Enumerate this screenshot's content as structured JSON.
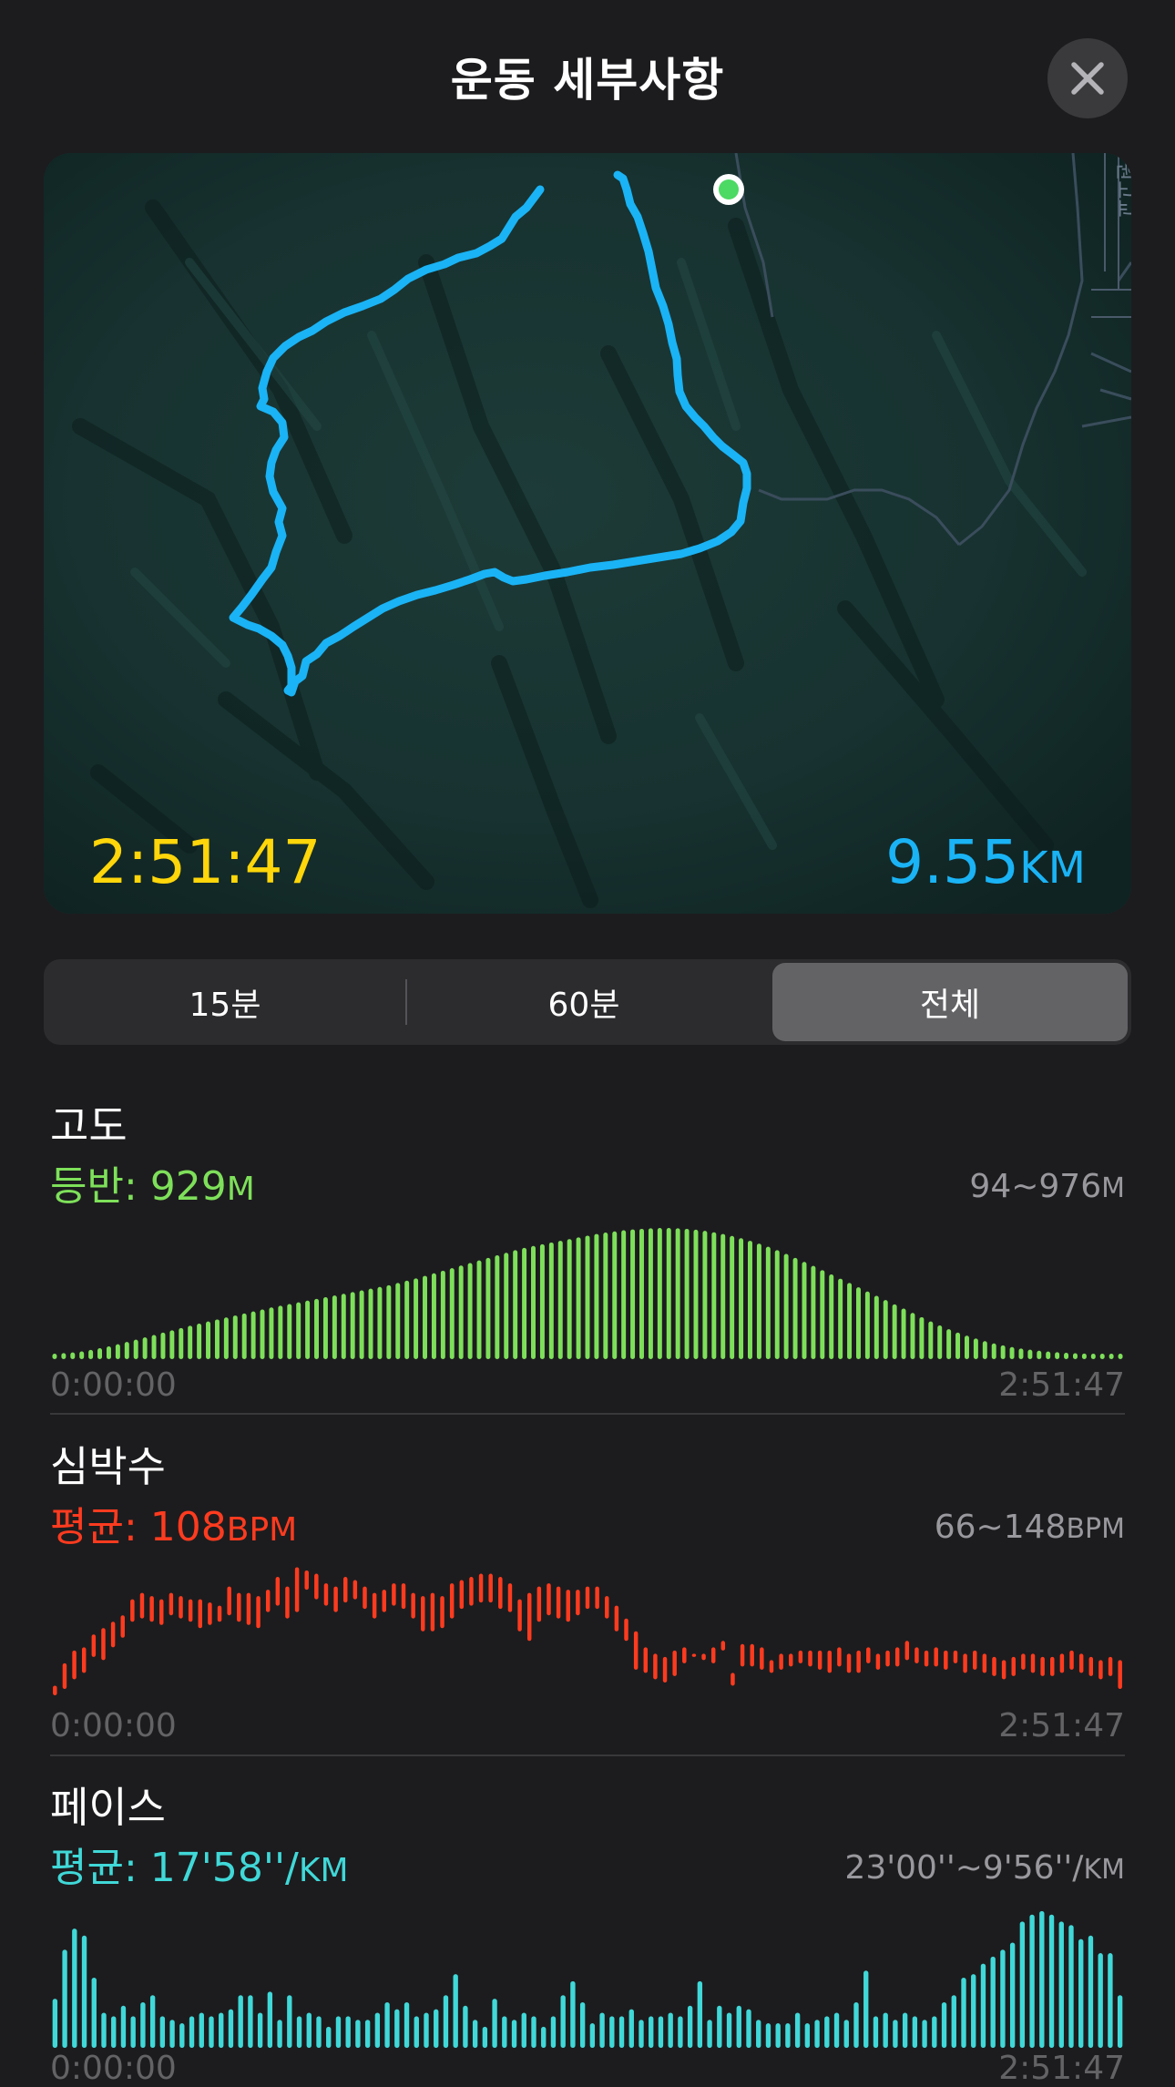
{
  "header": {
    "title": "운동 세부사항"
  },
  "map": {
    "duration": "2:51:47",
    "distance_value": "9.55",
    "distance_unit": "KM",
    "side_label": "원고교"
  },
  "range_tabs": [
    "15분",
    "60분",
    "전체"
  ],
  "selected_tab": "전체",
  "elevation": {
    "title": "고도",
    "stat_label": "등반: 929",
    "stat_unit": "M",
    "range_value": "94~976",
    "range_unit": "M",
    "start_time": "0:00:00",
    "end_time": "2:51:47",
    "color": "#7ee05a"
  },
  "heart_rate": {
    "title": "심박수",
    "stat_label": "평균: 108",
    "stat_unit": "BPM",
    "range_value": "66~148",
    "range_unit": "BPM",
    "start_time": "0:00:00",
    "end_time": "2:51:47",
    "color": "#ff3b1f"
  },
  "pace": {
    "title": "페이스",
    "stat_label": "평균: 17'58''/",
    "stat_unit": "KM",
    "range_value": "23'00''~9'56''/",
    "range_unit": "KM",
    "start_time": "0:00:00",
    "end_time": "2:51:47",
    "color": "#40d8d8"
  },
  "chart_data": [
    {
      "type": "bar",
      "name": "elevation",
      "ylim": [
        94,
        976
      ],
      "values": [
        94,
        98,
        103,
        110,
        120,
        132,
        145,
        160,
        176,
        192,
        208,
        225,
        242,
        258,
        274,
        290,
        305,
        320,
        334,
        348,
        362,
        376,
        390,
        404,
        418,
        430,
        442,
        454,
        466,
        478,
        490,
        502,
        514,
        526,
        538,
        550,
        562,
        574,
        590,
        606,
        622,
        640,
        658,
        676,
        694,
        712,
        730,
        748,
        766,
        784,
        802,
        820,
        836,
        850,
        862,
        874,
        886,
        898,
        910,
        922,
        934,
        944,
        952,
        960,
        966,
        970,
        974,
        976,
        976,
        974,
        970,
        964,
        956,
        946,
        934,
        920,
        904,
        886,
        866,
        844,
        820,
        794,
        766,
        738,
        710,
        680,
        650,
        620,
        590,
        560,
        530,
        500,
        470,
        440,
        410,
        380,
        350,
        320,
        292,
        266,
        242,
        220,
        200,
        182,
        166,
        152,
        140,
        130,
        122,
        115,
        109,
        104,
        100,
        97,
        95,
        94,
        94,
        94,
        94
      ],
      "start": "0:00:00",
      "end": "2:51:47"
    },
    {
      "type": "range-bar",
      "name": "heart_rate",
      "ylim": [
        66,
        148
      ],
      "ranges": [
        [
          66,
          72
        ],
        [
          70,
          86
        ],
        [
          76,
          94
        ],
        [
          80,
          96
        ],
        [
          90,
          104
        ],
        [
          88,
          108
        ],
        [
          96,
          112
        ],
        [
          102,
          116
        ],
        [
          112,
          126
        ],
        [
          114,
          130
        ],
        [
          112,
          128
        ],
        [
          110,
          126
        ],
        [
          116,
          130
        ],
        [
          114,
          128
        ],
        [
          112,
          126
        ],
        [
          108,
          126
        ],
        [
          110,
          124
        ],
        [
          112,
          122
        ],
        [
          116,
          134
        ],
        [
          112,
          130
        ],
        [
          110,
          130
        ],
        [
          108,
          128
        ],
        [
          118,
          132
        ],
        [
          122,
          140
        ],
        [
          114,
          134
        ],
        [
          118,
          146
        ],
        [
          132,
          144
        ],
        [
          126,
          142
        ],
        [
          122,
          136
        ],
        [
          118,
          134
        ],
        [
          124,
          140
        ],
        [
          126,
          138
        ],
        [
          120,
          134
        ],
        [
          114,
          130
        ],
        [
          118,
          132
        ],
        [
          122,
          136
        ],
        [
          120,
          136
        ],
        [
          114,
          130
        ],
        [
          106,
          128
        ],
        [
          106,
          130
        ],
        [
          108,
          128
        ],
        [
          114,
          136
        ],
        [
          120,
          138
        ],
        [
          122,
          140
        ],
        [
          124,
          142
        ],
        [
          124,
          142
        ],
        [
          120,
          140
        ],
        [
          118,
          136
        ],
        [
          106,
          126
        ],
        [
          100,
          130
        ],
        [
          112,
          134
        ],
        [
          116,
          136
        ],
        [
          114,
          134
        ],
        [
          112,
          132
        ],
        [
          116,
          132
        ],
        [
          120,
          134
        ],
        [
          120,
          134
        ],
        [
          114,
          128
        ],
        [
          106,
          122
        ],
        [
          100,
          114
        ],
        [
          82,
          106
        ],
        [
          80,
          96
        ],
        [
          76,
          92
        ],
        [
          74,
          90
        ],
        [
          78,
          94
        ],
        [
          86,
          96
        ],
        [
          90,
          92
        ],
        [
          88,
          92
        ],
        [
          86,
          96
        ],
        [
          94,
          100
        ],
        [
          72,
          80
        ],
        [
          84,
          98
        ],
        [
          84,
          98
        ],
        [
          82,
          96
        ],
        [
          80,
          88
        ],
        [
          82,
          92
        ],
        [
          84,
          92
        ],
        [
          86,
          94
        ],
        [
          84,
          94
        ],
        [
          82,
          94
        ],
        [
          80,
          94
        ],
        [
          84,
          96
        ],
        [
          80,
          92
        ],
        [
          80,
          94
        ],
        [
          86,
          96
        ],
        [
          82,
          92
        ],
        [
          84,
          94
        ],
        [
          84,
          96
        ],
        [
          88,
          100
        ],
        [
          86,
          96
        ],
        [
          84,
          94
        ],
        [
          84,
          96
        ],
        [
          82,
          94
        ],
        [
          86,
          94
        ],
        [
          80,
          92
        ],
        [
          82,
          94
        ],
        [
          80,
          92
        ],
        [
          78,
          90
        ],
        [
          76,
          88
        ],
        [
          78,
          90
        ],
        [
          82,
          92
        ],
        [
          80,
          92
        ],
        [
          78,
          90
        ],
        [
          78,
          90
        ],
        [
          80,
          92
        ],
        [
          82,
          94
        ],
        [
          80,
          92
        ],
        [
          78,
          90
        ],
        [
          76,
          88
        ],
        [
          78,
          90
        ],
        [
          70,
          88
        ]
      ],
      "start": "0:00:00",
      "end": "2:51:47"
    },
    {
      "type": "bar",
      "name": "pace",
      "values": [
        28,
        56,
        68,
        64,
        40,
        20,
        18,
        24,
        18,
        26,
        30,
        18,
        16,
        14,
        18,
        20,
        18,
        20,
        22,
        30,
        30,
        20,
        32,
        16,
        30,
        18,
        20,
        18,
        12,
        18,
        18,
        16,
        16,
        20,
        26,
        22,
        26,
        18,
        20,
        22,
        30,
        42,
        24,
        16,
        12,
        28,
        18,
        16,
        20,
        18,
        12,
        18,
        30,
        38,
        26,
        14,
        20,
        18,
        18,
        22,
        16,
        18,
        18,
        20,
        18,
        24,
        38,
        16,
        24,
        20,
        24,
        22,
        16,
        14,
        14,
        14,
        20,
        14,
        16,
        18,
        20,
        16,
        26,
        44,
        18,
        20,
        16,
        20,
        18,
        16,
        18,
        26,
        30,
        40,
        42,
        48,
        52,
        56,
        60,
        72,
        76,
        78,
        76,
        72,
        70,
        62,
        64,
        54,
        54,
        30
      ],
      "start": "0:00:00",
      "end": "2:51:47"
    }
  ]
}
